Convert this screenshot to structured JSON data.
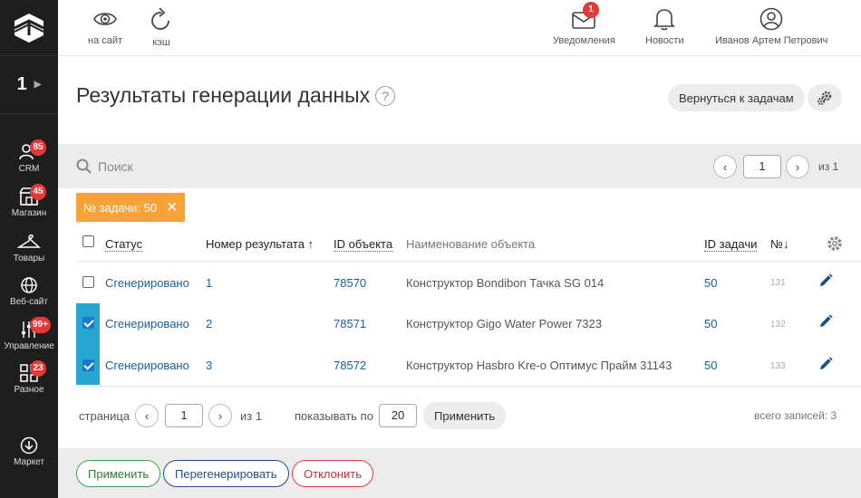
{
  "sidebar": {
    "project_number": "1",
    "items": [
      {
        "label": "CRM",
        "badge": "85"
      },
      {
        "label": "Магазин",
        "badge": "45"
      },
      {
        "label": "Товары",
        "badge": ""
      },
      {
        "label": "Веб-сайт",
        "badge": ""
      },
      {
        "label": "Управление",
        "badge": "99+"
      },
      {
        "label": "Разное",
        "badge": "23"
      },
      {
        "label": "Маркет",
        "badge": ""
      }
    ]
  },
  "topbar": {
    "site_label": "на сайт",
    "cache_label": "кэш",
    "notifications_label": "Уведомления",
    "notifications_badge": "1",
    "news_label": "Новости",
    "user_name": "Иванов Артем Петрович"
  },
  "header": {
    "title": "Результаты генерации данных",
    "help": "?",
    "back_button": "Вернуться к задачам"
  },
  "search": {
    "placeholder": "Поиск",
    "prev": "‹",
    "next": "›",
    "page": "1",
    "of_pages": "из 1"
  },
  "filter_chip": {
    "label": "№ задачи: 50",
    "close": "✕"
  },
  "table": {
    "headers": {
      "status": "Статус",
      "result_number": "Номер результата ↑",
      "object_id": "ID объекта",
      "object_name": "Наименование объекта",
      "task_id": "ID задачи",
      "no": "№↓"
    },
    "rows": [
      {
        "checked": false,
        "status": "Сгенерировано",
        "result_number": "1",
        "object_id": "78570",
        "object_name": "Конструктор Bondibon Тачка SG 014",
        "task_id": "50",
        "no": "131"
      },
      {
        "checked": true,
        "status": "Сгенерировано",
        "result_number": "2",
        "object_id": "78571",
        "object_name": "Конструктор Gigo Water Power 7323",
        "task_id": "50",
        "no": "132"
      },
      {
        "checked": true,
        "status": "Сгенерировано",
        "result_number": "3",
        "object_id": "78572",
        "object_name": "Конструктор Hasbro Kre-o Оптимус Прайм 31143",
        "task_id": "50",
        "no": "133"
      }
    ]
  },
  "pagination": {
    "page_label": "страница",
    "prev": "‹",
    "next": "›",
    "page": "1",
    "of_pages": "из 1",
    "show_label": "показывать по",
    "per_page": "20",
    "apply": "Применить",
    "total": "всего записей: 3"
  },
  "actions": {
    "apply": "Применить",
    "regenerate": "Перегенерировать",
    "reject": "Отклонить"
  }
}
